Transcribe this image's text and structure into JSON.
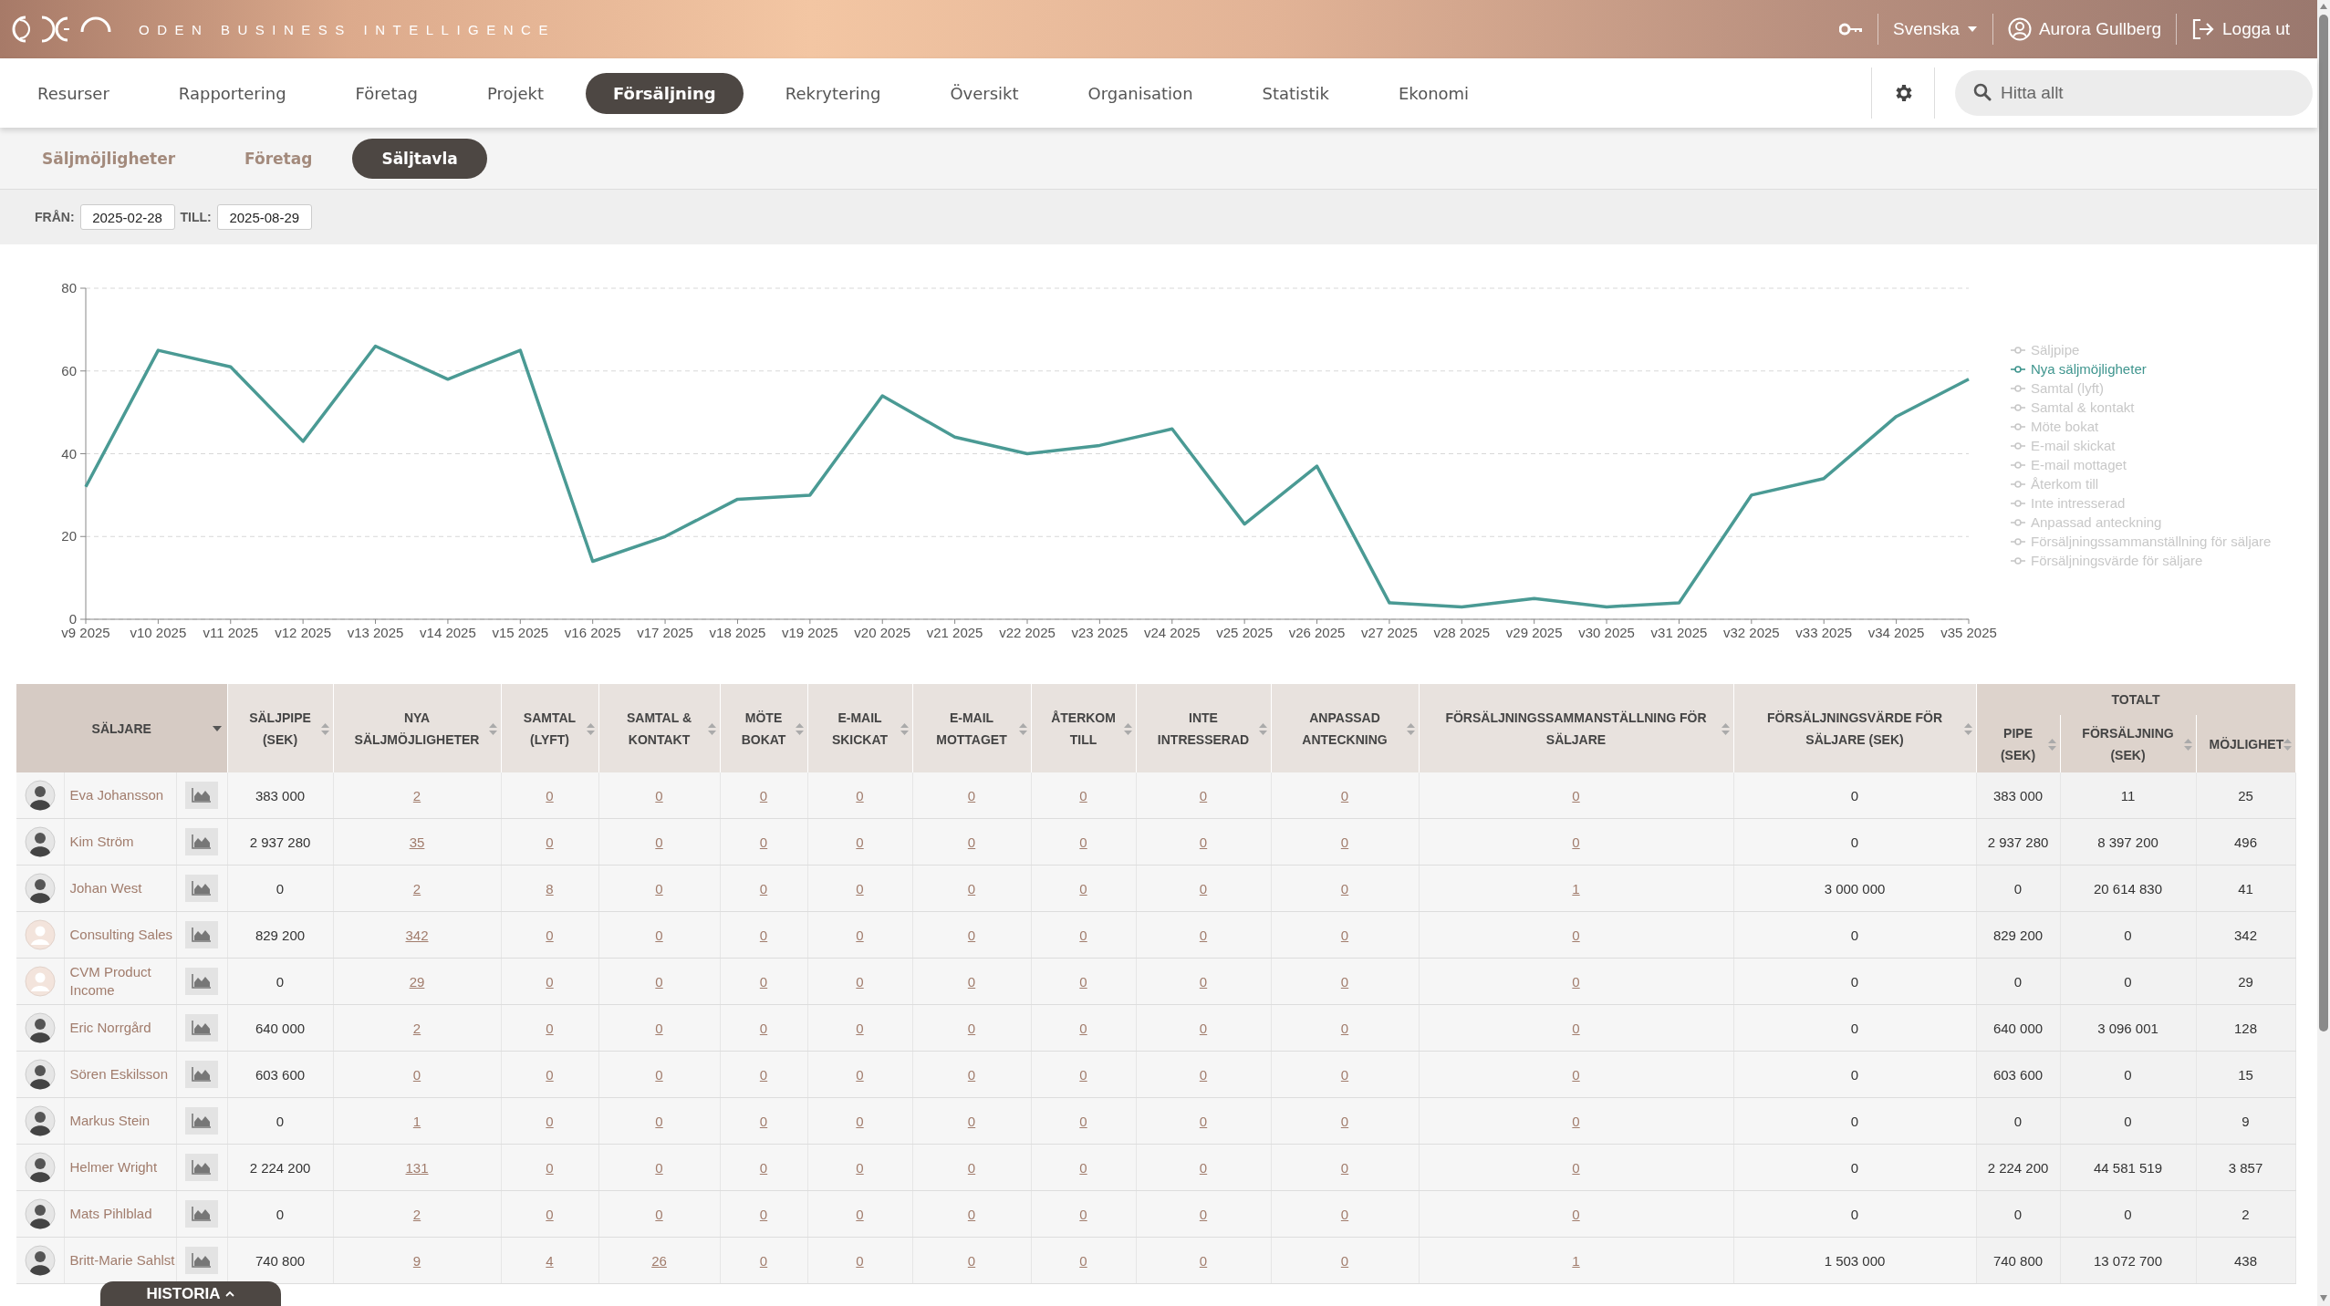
{
  "header": {
    "brand": "ODEN BUSINESS INTELLIGENCE",
    "language": "Svenska",
    "user": "Aurora Gullberg",
    "logout": "Logga ut"
  },
  "nav": {
    "items": [
      {
        "label": "Resurser",
        "selected": false
      },
      {
        "label": "Rapportering",
        "selected": false
      },
      {
        "label": "Företag",
        "selected": false
      },
      {
        "label": "Projekt",
        "selected": false
      },
      {
        "label": "Försäljning",
        "selected": true
      },
      {
        "label": "Rekrytering",
        "selected": false
      },
      {
        "label": "Översikt",
        "selected": false
      },
      {
        "label": "Organisation",
        "selected": false
      },
      {
        "label": "Statistik",
        "selected": false
      },
      {
        "label": "Ekonomi",
        "selected": false
      }
    ],
    "search": {
      "placeholder": "Hitta allt"
    }
  },
  "subnav": [
    {
      "label": "Säljmöjligheter",
      "selected": false
    },
    {
      "label": "Företag",
      "selected": false
    },
    {
      "label": "Säljtavla",
      "selected": true
    }
  ],
  "filter": {
    "from_label": "FRÅN:",
    "from": "2025-02-28",
    "to_label": "TILL:",
    "to": "2025-08-29"
  },
  "chart": {
    "chart_data": {
      "type": "line",
      "categories": [
        "v9 2025",
        "v10 2025",
        "v11 2025",
        "v12 2025",
        "v13 2025",
        "v14 2025",
        "v15 2025",
        "v16 2025",
        "v17 2025",
        "v18 2025",
        "v19 2025",
        "v20 2025",
        "v21 2025",
        "v22 2025",
        "v23 2025",
        "v24 2025",
        "v25 2025",
        "v26 2025",
        "v27 2025",
        "v28 2025",
        "v29 2025",
        "v30 2025",
        "v31 2025",
        "v32 2025",
        "v33 2025",
        "v34 2025",
        "v35 2025"
      ],
      "grid": true,
      "series": [
        {
          "color": "#4a9a94",
          "values": [
            32,
            65,
            61,
            43,
            66,
            58,
            65,
            14,
            20,
            29,
            30,
            54,
            44,
            40,
            42,
            46,
            23,
            37,
            4,
            3,
            5,
            3,
            4,
            30,
            34,
            49,
            58
          ]
        }
      ],
      "ylim": [
        0,
        80
      ],
      "yticks": [
        0,
        20,
        40,
        60,
        80
      ]
    },
    "legend": [
      {
        "label": "Säljpipe",
        "selected": false
      },
      {
        "label": "Nya säljmöjligheter",
        "selected": true
      },
      {
        "label": "Samtal (lyft)",
        "selected": false
      },
      {
        "label": "Samtal & kontakt",
        "selected": false
      },
      {
        "label": "Möte bokat",
        "selected": false
      },
      {
        "label": "E-mail skickat",
        "selected": false
      },
      {
        "label": "E-mail mottaget",
        "selected": false
      },
      {
        "label": "Återkom till",
        "selected": false
      },
      {
        "label": "Inte intresserad",
        "selected": false
      },
      {
        "label": "Anpassad anteckning",
        "selected": false
      },
      {
        "label": "Försäljningssammanställning för säljare",
        "selected": false
      },
      {
        "label": "Försäljningsvärde för säljare",
        "selected": false
      }
    ]
  },
  "table": {
    "name_header": "SÄLJARE",
    "group_header": "TOTALT",
    "columns": [
      {
        "label": "SÄLJPIPE (SEK)",
        "kind": "number"
      },
      {
        "label": "NYA SÄLJMÖJLIGHETER",
        "kind": "link"
      },
      {
        "label": "SAMTAL (LYFT)",
        "kind": "link"
      },
      {
        "label": "SAMTAL & KONTAKT",
        "kind": "link"
      },
      {
        "label": "MÖTE BOKAT",
        "kind": "link"
      },
      {
        "label": "E-MAIL SKICKAT",
        "kind": "link"
      },
      {
        "label": "E-MAIL MOTTAGET",
        "kind": "link"
      },
      {
        "label": "ÅTERKOM TILL",
        "kind": "link"
      },
      {
        "label": "INTE INTRESSERAD",
        "kind": "link"
      },
      {
        "label": "ANPASSAD ANTECKNING",
        "kind": "link"
      },
      {
        "label": "FÖRSÄLJNINGSSAMMANSTÄLLNING FÖR SÄLJARE",
        "kind": "link"
      },
      {
        "label": "FÖRSÄLJNINGSVÄRDE FÖR SÄLJARE (SEK)",
        "kind": "number"
      },
      {
        "label": "PIPE (SEK)",
        "kind": "number"
      },
      {
        "label": "FÖRSÄLJNING (SEK)",
        "kind": "number"
      },
      {
        "label": "MÖJLIGHET",
        "kind": "number"
      }
    ],
    "rows": [
      {
        "name": "Eva Johansson",
        "kind": "person",
        "cells": [
          "383 000",
          "2",
          "0",
          "0",
          "0",
          "0",
          "0",
          "0",
          "0",
          "0",
          "0",
          "0",
          "383 000",
          "11",
          "25"
        ]
      },
      {
        "name": "Kim Ström",
        "kind": "person",
        "cells": [
          "2 937 280",
          "35",
          "0",
          "0",
          "0",
          "0",
          "0",
          "0",
          "0",
          "0",
          "0",
          "0",
          "2 937 280",
          "8 397 200",
          "496"
        ]
      },
      {
        "name": "Johan West",
        "kind": "person",
        "cells": [
          "0",
          "2",
          "8",
          "0",
          "0",
          "0",
          "0",
          "0",
          "0",
          "0",
          "1",
          "3 000 000",
          "0",
          "20 614 830",
          "41"
        ]
      },
      {
        "name": "Consulting Sales",
        "kind": "placeholder",
        "cells": [
          "829 200",
          "342",
          "0",
          "0",
          "0",
          "0",
          "0",
          "0",
          "0",
          "0",
          "0",
          "0",
          "829 200",
          "0",
          "342"
        ]
      },
      {
        "name": "CVM Product Income",
        "kind": "placeholder",
        "cells": [
          "0",
          "29",
          "0",
          "0",
          "0",
          "0",
          "0",
          "0",
          "0",
          "0",
          "0",
          "0",
          "0",
          "0",
          "29"
        ]
      },
      {
        "name": "Eric Norrgård",
        "kind": "person",
        "cells": [
          "640 000",
          "2",
          "0",
          "0",
          "0",
          "0",
          "0",
          "0",
          "0",
          "0",
          "0",
          "0",
          "640 000",
          "3 096 001",
          "128"
        ]
      },
      {
        "name": "Sören Eskilsson",
        "kind": "person",
        "cells": [
          "603 600",
          "0",
          "0",
          "0",
          "0",
          "0",
          "0",
          "0",
          "0",
          "0",
          "0",
          "0",
          "603 600",
          "0",
          "15"
        ]
      },
      {
        "name": "Markus Stein",
        "kind": "person",
        "cells": [
          "0",
          "1",
          "0",
          "0",
          "0",
          "0",
          "0",
          "0",
          "0",
          "0",
          "0",
          "0",
          "0",
          "0",
          "9"
        ]
      },
      {
        "name": "Helmer Wright",
        "kind": "person",
        "cells": [
          "2 224 200",
          "131",
          "0",
          "0",
          "0",
          "0",
          "0",
          "0",
          "0",
          "0",
          "0",
          "0",
          "2 224 200",
          "44 581 519",
          "3 857"
        ]
      },
      {
        "name": "Mats Pihlblad",
        "kind": "person",
        "cells": [
          "0",
          "2",
          "0",
          "0",
          "0",
          "0",
          "0",
          "0",
          "0",
          "0",
          "0",
          "0",
          "0",
          "0",
          "2"
        ]
      },
      {
        "name": "Britt-Marie Sahlst",
        "kind": "person",
        "cells": [
          "740 800",
          "9",
          "4",
          "26",
          "0",
          "0",
          "0",
          "0",
          "0",
          "0",
          "1",
          "1 503 000",
          "740 800",
          "13 072 700",
          "438"
        ]
      }
    ]
  },
  "history_tab": "HISTORIA"
}
